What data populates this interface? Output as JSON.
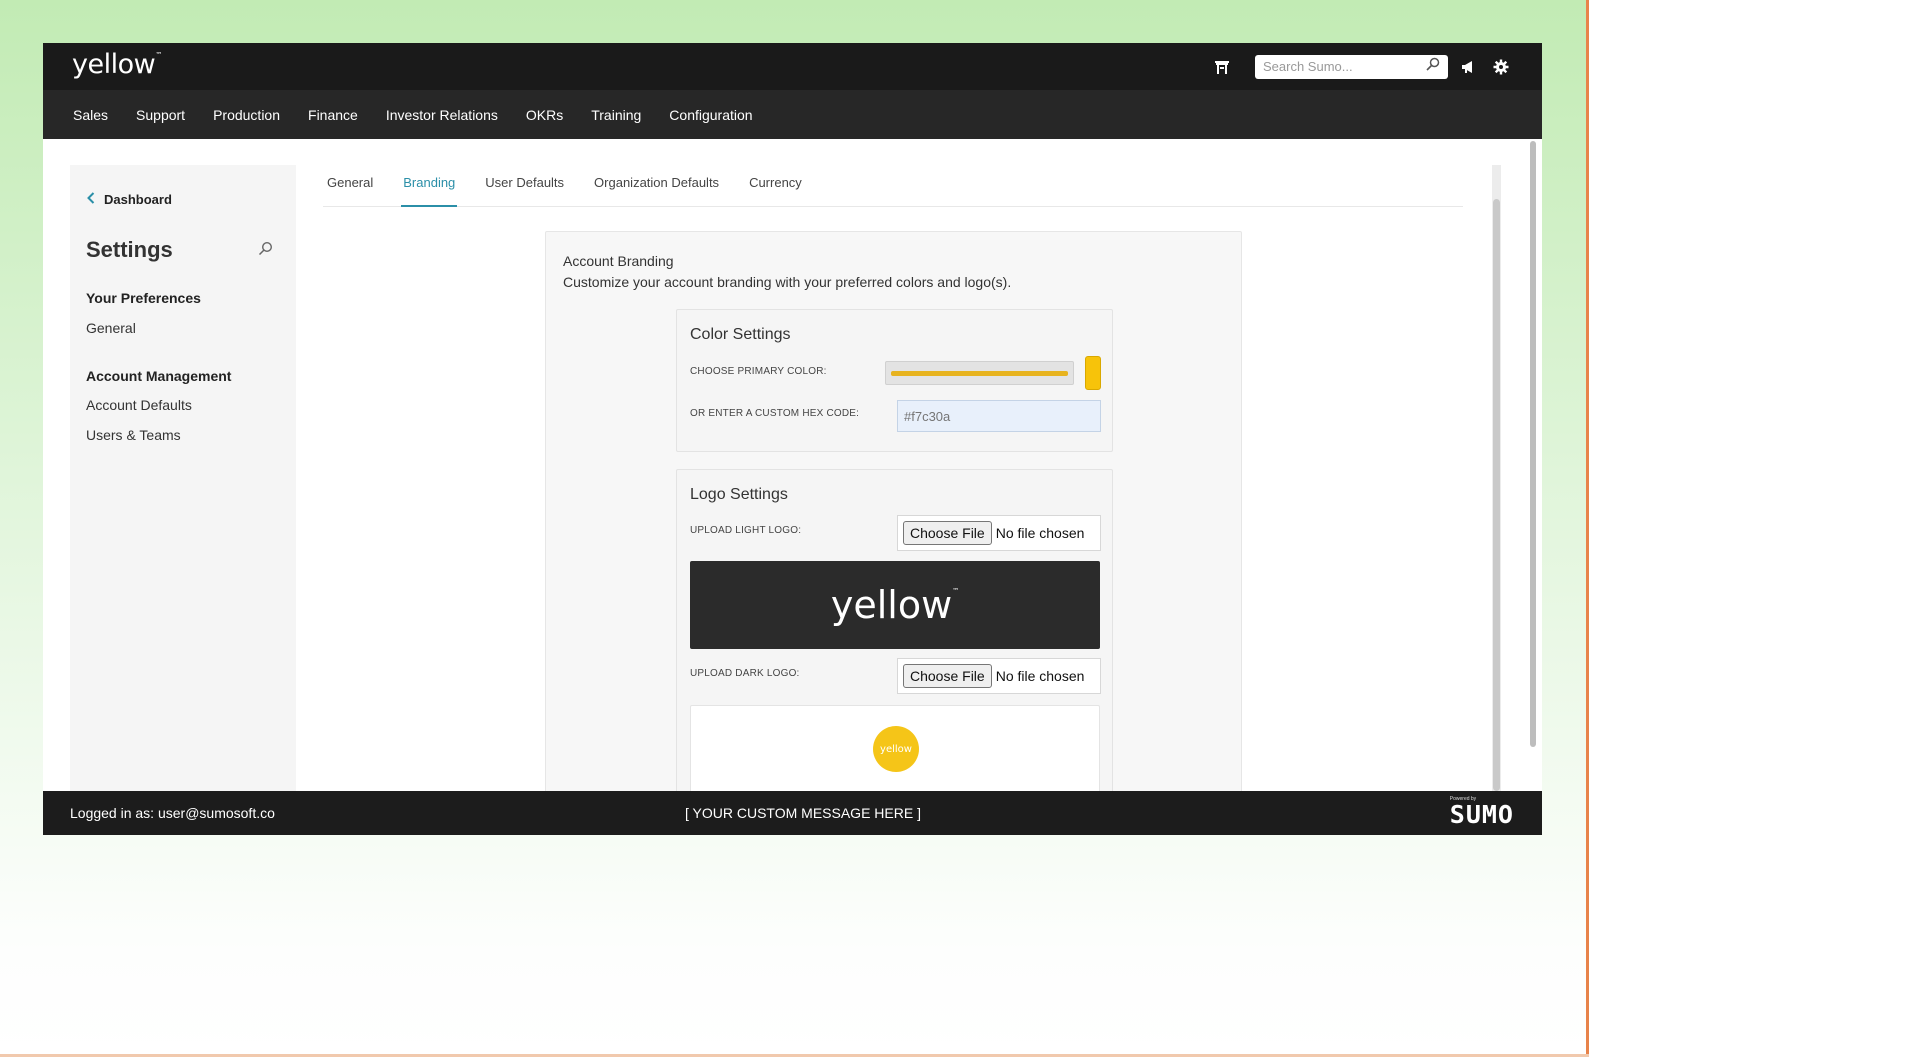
{
  "app": {
    "brand": "yellow",
    "brand_mark": "™"
  },
  "search": {
    "placeholder": "Search Sumo..."
  },
  "nav": {
    "items": [
      "Sales",
      "Support",
      "Production",
      "Finance",
      "Investor Relations",
      "OKRs",
      "Training",
      "Configuration"
    ]
  },
  "sidebar": {
    "back_label": "Dashboard",
    "title": "Settings",
    "sections": [
      {
        "heading": "Your Preferences",
        "links": [
          "General"
        ]
      },
      {
        "heading": "Account Management",
        "links": [
          "Account Defaults",
          "Users & Teams"
        ]
      }
    ]
  },
  "tabs": {
    "items": [
      "General",
      "Branding",
      "User Defaults",
      "Organization Defaults",
      "Currency"
    ],
    "active": "Branding"
  },
  "branding": {
    "title": "Account Branding",
    "description": "Customize your account branding with your preferred colors and logo(s).",
    "color_settings": {
      "title": "Color Settings",
      "primary_label": "CHOOSE PRIMARY COLOR:",
      "hex_label": "OR ENTER A CUSTOM HEX CODE:",
      "hex_placeholder": "#f7c30a",
      "primary_color": "#f7c30a"
    },
    "logo_settings": {
      "title": "Logo Settings",
      "light_label": "UPLOAD LIGHT LOGO:",
      "dark_label": "UPLOAD DARK LOGO:",
      "choose_file": "Choose File",
      "no_file": "No file chosen",
      "preview_logo": "yellow",
      "preview_logo_mark": "™",
      "circle_logo": "yellow"
    }
  },
  "footer": {
    "login": "Logged in as: user@sumosoft.co",
    "message": "[ YOUR CUSTOM MESSAGE HERE ]",
    "powered_by": "Powered by",
    "logo": "SUMO"
  },
  "colors": {
    "accent": "#2b8fa8",
    "topbar": "#1a1a1a",
    "navbar": "#272727",
    "brand_yellow": "#f7c30a"
  },
  "icons": [
    "store-icon",
    "search-icon",
    "megaphone-icon",
    "gear-icon",
    "chevron-left-icon"
  ]
}
